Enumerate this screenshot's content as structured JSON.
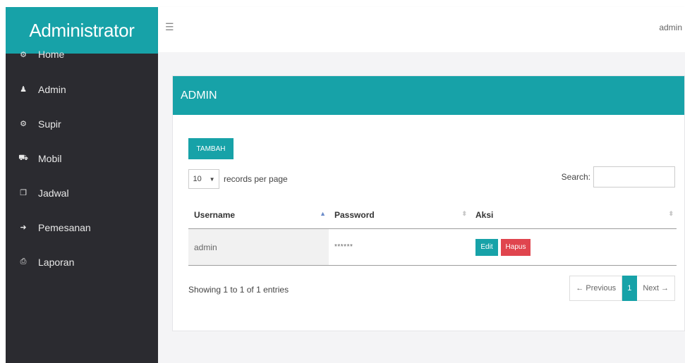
{
  "app": {
    "brand": "Administrator",
    "user": "admin",
    "menu_icon": "☰"
  },
  "sidebar": {
    "items": [
      {
        "label": "Home",
        "icon": "dashboard-icon",
        "glyph": "⚙"
      },
      {
        "label": "Admin",
        "icon": "user-icon",
        "glyph": "♟"
      },
      {
        "label": "Supir",
        "icon": "dashboard-icon",
        "glyph": "⚙"
      },
      {
        "label": "Mobil",
        "icon": "car-icon",
        "glyph": "⛟"
      },
      {
        "label": "Jadwal",
        "icon": "copy-icon",
        "glyph": "❐"
      },
      {
        "label": "Pemesanan",
        "icon": "sign-in-icon",
        "glyph": "➜"
      },
      {
        "label": "Laporan",
        "icon": "print-icon",
        "glyph": "⎙"
      }
    ]
  },
  "panel": {
    "title": "ADMIN",
    "add_button": "TAMBAH",
    "length": {
      "value": "10",
      "label": "records per page"
    },
    "search": {
      "label": "Search:",
      "value": "",
      "placeholder": ""
    },
    "table": {
      "columns": [
        "Username",
        "Password",
        "Aksi"
      ],
      "rows": [
        {
          "username": "admin",
          "password": "******",
          "edit_label": "Edit",
          "delete_label": "Hapus"
        }
      ]
    },
    "info": "Showing 1 to 1 of 1 entries",
    "pagination": {
      "previous": "← Previous",
      "current": "1",
      "next": "Next →"
    }
  },
  "colors": {
    "accent": "#17a2a8",
    "sidebar": "#2b2b30",
    "danger": "#e0454e"
  }
}
